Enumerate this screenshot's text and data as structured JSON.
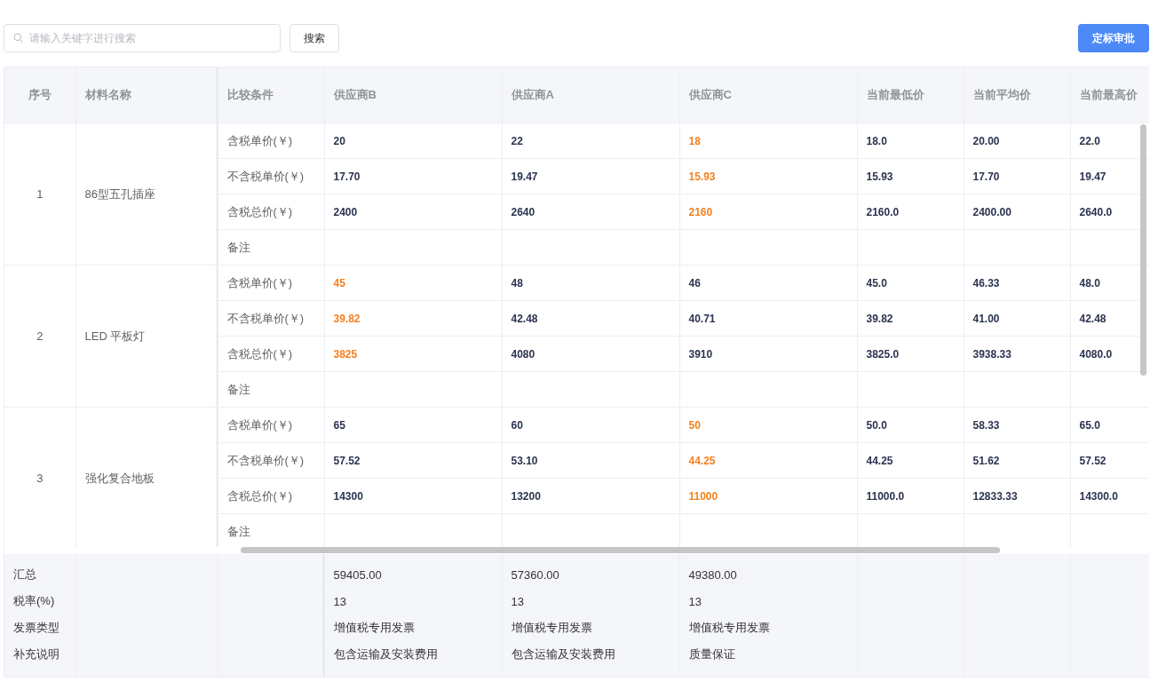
{
  "toolbar": {
    "search": {
      "placeholder": "请输入关键字进行搜索"
    },
    "search_button": "搜索",
    "approve_button": "定标审批"
  },
  "table": {
    "columns": [
      "序号",
      "材料名称",
      "比较条件",
      "供应商B",
      "供应商A",
      "供应商C",
      "当前最低价",
      "当前平均价",
      "当前最高价"
    ],
    "rows": [
      {
        "index": "1",
        "name": "86型五孔插座",
        "conditions": [
          {
            "label": "含税单价(￥)",
            "cells": [
              {
                "text": "20",
                "lowest": false
              },
              {
                "text": "22",
                "lowest": false
              },
              {
                "text": "18",
                "lowest": true
              }
            ],
            "min": "18.0",
            "avg": "20.00",
            "max": "22.0"
          },
          {
            "label": "不含税单价(￥)",
            "cells": [
              {
                "text": "17.70",
                "lowest": false
              },
              {
                "text": "19.47",
                "lowest": false
              },
              {
                "text": "15.93",
                "lowest": true
              }
            ],
            "min": "15.93",
            "avg": "17.70",
            "max": "19.47"
          },
          {
            "label": "含税总价(￥)",
            "cells": [
              {
                "text": "2400",
                "lowest": false
              },
              {
                "text": "2640",
                "lowest": false
              },
              {
                "text": "2160",
                "lowest": true
              }
            ],
            "min": "2160.0",
            "avg": "2400.00",
            "max": "2640.0"
          },
          {
            "label": "备注"
          }
        ]
      },
      {
        "index": "2",
        "name": "LED 平板灯",
        "conditions": [
          {
            "label": "含税单价(￥)",
            "cells": [
              {
                "text": "45",
                "lowest": true
              },
              {
                "text": "48",
                "lowest": false
              },
              {
                "text": "46",
                "lowest": false
              }
            ],
            "min": "45.0",
            "avg": "46.33",
            "max": "48.0"
          },
          {
            "label": "不含税单价(￥)",
            "cells": [
              {
                "text": "39.82",
                "lowest": true
              },
              {
                "text": "42.48",
                "lowest": false
              },
              {
                "text": "40.71",
                "lowest": false
              }
            ],
            "min": "39.82",
            "avg": "41.00",
            "max": "42.48"
          },
          {
            "label": "含税总价(￥)",
            "cells": [
              {
                "text": "3825",
                "lowest": true
              },
              {
                "text": "4080",
                "lowest": false
              },
              {
                "text": "3910",
                "lowest": false
              }
            ],
            "min": "3825.0",
            "avg": "3938.33",
            "max": "4080.0"
          },
          {
            "label": "备注"
          }
        ]
      },
      {
        "index": "3",
        "name": "强化复合地板",
        "conditions": [
          {
            "label": "含税单价(￥)",
            "cells": [
              {
                "text": "65",
                "lowest": false
              },
              {
                "text": "60",
                "lowest": false
              },
              {
                "text": "50",
                "lowest": true
              }
            ],
            "min": "50.0",
            "avg": "58.33",
            "max": "65.0"
          },
          {
            "label": "不含税单价(￥)",
            "cells": [
              {
                "text": "57.52",
                "lowest": false
              },
              {
                "text": "53.10",
                "lowest": false
              },
              {
                "text": "44.25",
                "lowest": true
              }
            ],
            "min": "44.25",
            "avg": "51.62",
            "max": "57.52"
          },
          {
            "label": "含税总价(￥)",
            "cells": [
              {
                "text": "14300",
                "lowest": false
              },
              {
                "text": "13200",
                "lowest": false
              },
              {
                "text": "11000",
                "lowest": true
              }
            ],
            "min": "11000.0",
            "avg": "12833.33",
            "max": "14300.0"
          },
          {
            "label": "备注"
          }
        ]
      }
    ],
    "summary": {
      "labels": [
        "汇总",
        "税率(%)",
        "发票类型",
        "补充说明"
      ],
      "suppliers": [
        [
          "59405.00",
          "13",
          "增值税专用发票",
          "包含运输及安装费用"
        ],
        [
          "57360.00",
          "13",
          "增值税专用发票",
          "包含运输及安装费用"
        ],
        [
          "49380.00",
          "13",
          "增值税专用发票",
          "质量保证"
        ]
      ]
    }
  }
}
